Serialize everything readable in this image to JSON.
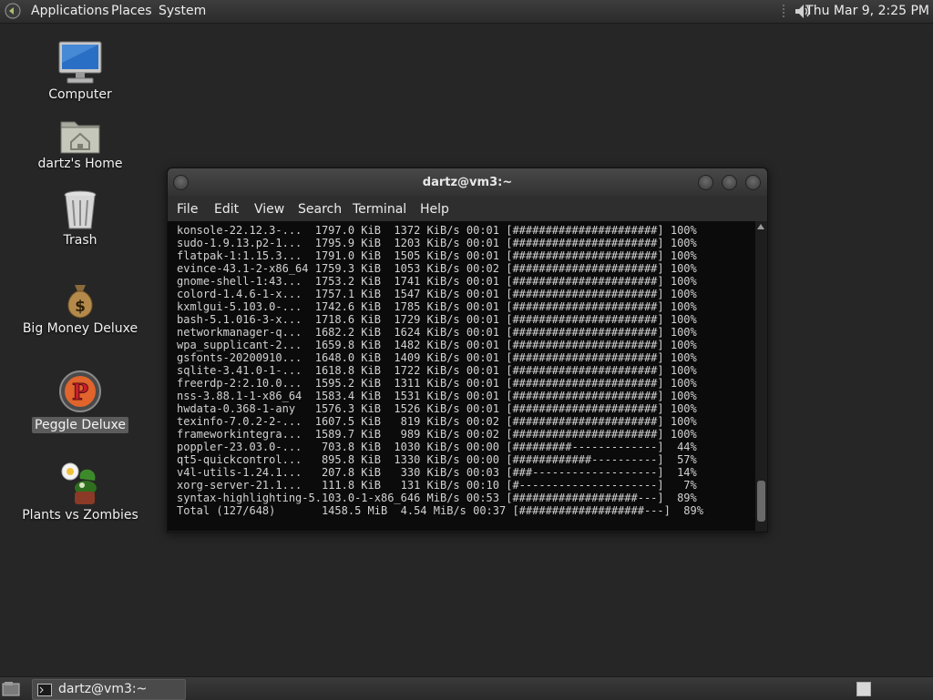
{
  "top_panel": {
    "menus": [
      "Applications",
      "Places",
      "System"
    ],
    "clock": "Thu Mar  9,  2:25 PM",
    "logo_icon": "gnome-foot-icon",
    "volume_icon": "speaker-volume-icon"
  },
  "desktop_icons": [
    {
      "label": "Computer",
      "icon": "computer-monitor-icon"
    },
    {
      "label": "dartz's Home",
      "icon": "home-folder-icon"
    },
    {
      "label": "Trash",
      "icon": "trash-bin-icon"
    },
    {
      "label": "Big Money Deluxe",
      "icon": "money-bag-icon"
    },
    {
      "label": "Peggle Deluxe",
      "icon": "peggle-ball-icon"
    },
    {
      "label": "Plants vs Zombies",
      "icon": "plants-vs-zombies-icon"
    }
  ],
  "terminal": {
    "title": "dartz@vm3:~",
    "menus": [
      "File",
      "Edit",
      "View",
      "Search",
      "Terminal",
      "Help"
    ],
    "lines": [
      "konsole-22.12.3-...  1797.0 KiB  1372 KiB/s 00:01 [######################] 100%",
      "sudo-1.9.13.p2-1...  1795.9 KiB  1203 KiB/s 00:01 [######################] 100%",
      "flatpak-1:1.15.3...  1791.0 KiB  1505 KiB/s 00:01 [######################] 100%",
      "evince-43.1-2-x86_64 1759.3 KiB  1053 KiB/s 00:02 [######################] 100%",
      "gnome-shell-1:43...  1753.2 KiB  1741 KiB/s 00:01 [######################] 100%",
      "colord-1.4.6-1-x...  1757.1 KiB  1547 KiB/s 00:01 [######################] 100%",
      "kxmlgui-5.103.0-...  1742.6 KiB  1785 KiB/s 00:01 [######################] 100%",
      "bash-5.1.016-3-x...  1718.6 KiB  1729 KiB/s 00:01 [######################] 100%",
      "networkmanager-q...  1682.2 KiB  1624 KiB/s 00:01 [######################] 100%",
      "wpa_supplicant-2...  1659.8 KiB  1482 KiB/s 00:01 [######################] 100%",
      "gsfonts-20200910...  1648.0 KiB  1409 KiB/s 00:01 [######################] 100%",
      "sqlite-3.41.0-1-...  1618.8 KiB  1722 KiB/s 00:01 [######################] 100%",
      "freerdp-2:2.10.0...  1595.2 KiB  1311 KiB/s 00:01 [######################] 100%",
      "nss-3.88.1-1-x86_64  1583.4 KiB  1531 KiB/s 00:01 [######################] 100%",
      "hwdata-0.368-1-any   1576.3 KiB  1526 KiB/s 00:01 [######################] 100%",
      "texinfo-7.0.2-2-...  1607.5 KiB   819 KiB/s 00:02 [######################] 100%",
      "frameworkintegra...  1589.7 KiB   989 KiB/s 00:02 [######################] 100%",
      "poppler-23.03.0-...   703.8 KiB  1030 KiB/s 00:00 [#########-------------]  44%",
      "qt5-quickcontrol...   895.8 KiB  1330 KiB/s 00:00 [############----------]  57%",
      "v4l-utils-1.24.1...   207.8 KiB   330 KiB/s 00:03 [###-------------------]  14%",
      "xorg-server-21.1...   111.8 KiB   131 KiB/s 00:10 [#---------------------]   7%",
      "syntax-highlighting-5.103.0-1-x86_646 MiB/s 00:53 [###################---]  89%",
      "Total (127/648)       1458.5 MiB  4.54 MiB/s 00:37 [###################---]  89%"
    ]
  },
  "bottom_panel": {
    "task_label": "dartz@vm3:~",
    "task_icon": "terminal-icon",
    "show_desktop_icon": "show-desktop-icon",
    "workspace_icon": "workspace-switcher-icon"
  }
}
